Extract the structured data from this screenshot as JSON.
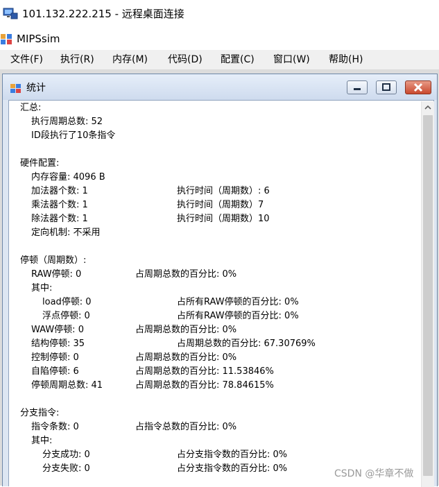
{
  "remote_desktop": {
    "title": "101.132.222.215 - 远程桌面连接",
    "icon": "remote-desktop-icon"
  },
  "app": {
    "title": "MIPSsim",
    "icon": "app-icon"
  },
  "menu": [
    "文件(F)",
    "执行(R)",
    "内存(M)",
    "代码(D)",
    "配置(C)",
    "窗口(W)",
    "帮助(H)"
  ],
  "child_window": {
    "title": "统计",
    "icon": "stats-window-icon",
    "buttons": [
      "minimize-icon",
      "maximize-icon",
      "close-icon"
    ]
  },
  "stats": [
    "汇总:",
    "执行周期总数: 52",
    "ID段执行了10条指令",
    "硬件配置:",
    "内存容量: 4096 B",
    "加法器个数: 1",
    "执行时间（周期数）: 6",
    "乘法器个数: 1",
    "执行时间（周期数）7",
    "除法器个数: 1",
    "执行时间（周期数）10",
    "定向机制: 不采用",
    "停顿（周期数）:",
    "RAW停顿: 0",
    "占周期总数的百分比: 0%",
    "其中:",
    "load停顿: 0",
    "占所有RAW停顿的百分比: 0%",
    "浮点停顿: 0",
    "占所有RAW停顿的百分比: 0%",
    "WAW停顿: 0",
    "占周期总数的百分比: 0%",
    "结构停顿: 35",
    "占周期总数的百分比: 67.30769%",
    "控制停顿: 0",
    "占周期总数的百分比: 0%",
    "自陷停顿: 6",
    "占周期总数的百分比: 11.53846%",
    "停顿周期总数: 41",
    "占周期总数的百分比: 78.84615%",
    "分支指令:",
    "指令条数: 0",
    "占指令总数的百分比: 0%",
    "其中:",
    "分支成功: 0",
    "占分支指令数的百分比: 0%",
    "分支失败: 0",
    "占分支指令数的百分比: 0%"
  ],
  "watermark": "CSDN @华章不做",
  "colors": {
    "menubar": "#f0f0f0",
    "child_title": "#dde6f2",
    "close_button": "#c9492f"
  }
}
